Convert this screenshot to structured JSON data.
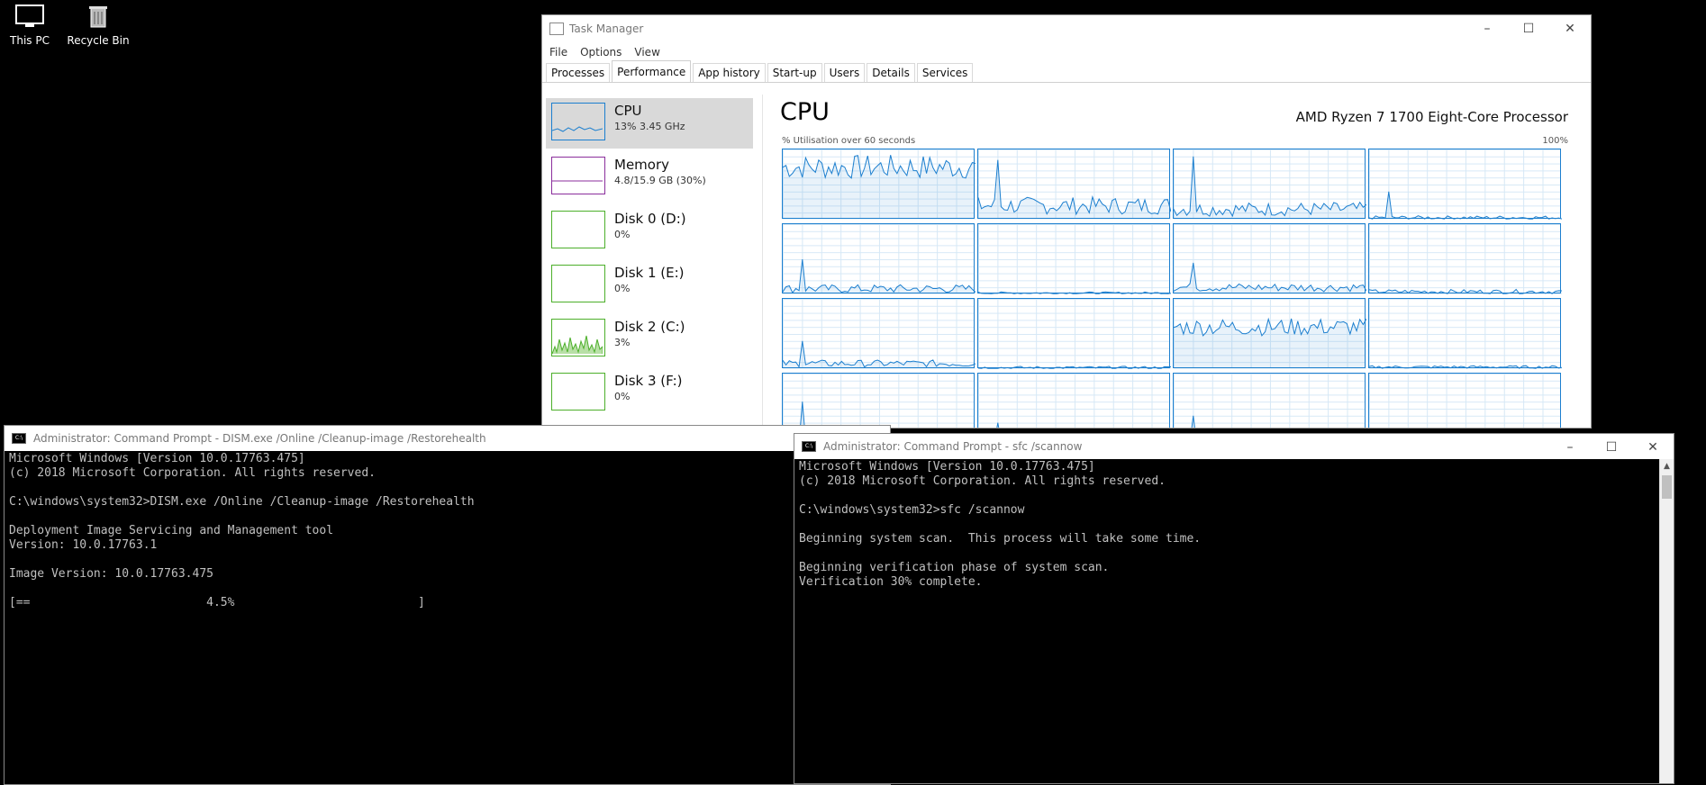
{
  "desktop": {
    "icons": [
      {
        "label": "This PC",
        "icon": "monitor-icon"
      },
      {
        "label": "Recycle Bin",
        "icon": "recycle-bin-icon"
      }
    ]
  },
  "task_manager": {
    "title": "Task Manager",
    "menu": [
      "File",
      "Options",
      "View"
    ],
    "tabs": [
      "Processes",
      "Performance",
      "App history",
      "Start-up",
      "Users",
      "Details",
      "Services"
    ],
    "active_tab": "Performance",
    "items": [
      {
        "name": "CPU",
        "value": "13% 3.45 GHz",
        "color": "#1c7fcf"
      },
      {
        "name": "Memory",
        "value": "4.8/15.9 GB (30%)",
        "color": "#8b2e9c"
      },
      {
        "name": "Disk 0 (D:)",
        "value": "0%",
        "color": "#4caf2a"
      },
      {
        "name": "Disk 1 (E:)",
        "value": "0%",
        "color": "#4caf2a"
      },
      {
        "name": "Disk 2 (C:)",
        "value": "3%",
        "color": "#4caf2a"
      },
      {
        "name": "Disk 3 (F:)",
        "value": "0%",
        "color": "#4caf2a"
      }
    ],
    "cpu_panel": {
      "title": "CPU",
      "model": "AMD Ryzen 7 1700 Eight-Core Processor",
      "util_label": "% Utilisation over 60 seconds",
      "util_max": "100%"
    }
  },
  "cmd_dism": {
    "title": "Administrator: Command Prompt - DISM.exe  /Online /Cleanup-image /Restorehealth",
    "lines": [
      "Microsoft Windows [Version 10.0.17763.475]",
      "(c) 2018 Microsoft Corporation. All rights reserved.",
      "",
      "C:\\windows\\system32>DISM.exe /Online /Cleanup-image /Restorehealth",
      "",
      "Deployment Image Servicing and Management tool",
      "Version: 10.0.17763.1",
      "",
      "Image Version: 10.0.17763.475",
      "",
      "[==                         4.5%                          ]"
    ]
  },
  "cmd_sfc": {
    "title": "Administrator: Command Prompt - sfc  /scannow",
    "lines": [
      "Microsoft Windows [Version 10.0.17763.475]",
      "(c) 2018 Microsoft Corporation. All rights reserved.",
      "",
      "C:\\windows\\system32>sfc /scannow",
      "",
      "Beginning system scan.  This process will take some time.",
      "",
      "Beginning verification phase of system scan.",
      "Verification 30% complete."
    ]
  }
}
